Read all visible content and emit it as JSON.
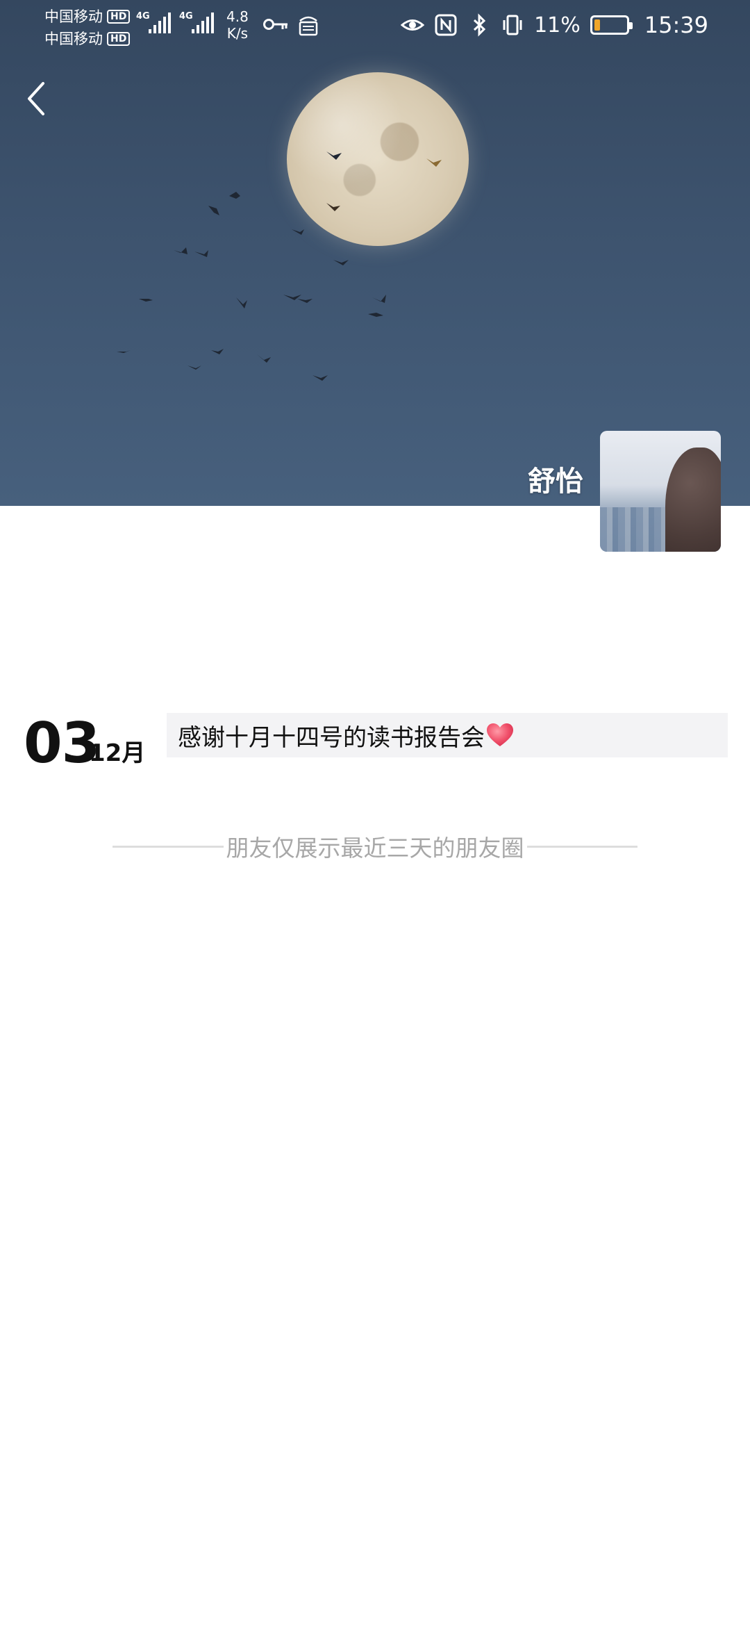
{
  "status_bar": {
    "carriers": [
      "中国移动",
      "中国移动"
    ],
    "hd_badge": "HD",
    "network_type": "4G",
    "net_speed_value": "4.8",
    "net_speed_unit": "K/s",
    "battery_percent": "11%",
    "battery_level": 0.11,
    "time": "15:39",
    "icons": [
      "key-icon",
      "vpn-icon",
      "eye-icon",
      "nfc-icon",
      "bluetooth-icon",
      "vibrate-icon",
      "battery-icon"
    ]
  },
  "header": {
    "back_icon": "chevron-left-icon",
    "user_name": "舒怡"
  },
  "posts": [
    {
      "day": "03",
      "month": "12月",
      "text": "感谢十月十四号的读书报告会",
      "emoji": "heart-icon"
    }
  ],
  "footer_notice": "朋友仅展示最近三天的朋友圈",
  "colors": {
    "cover_sky": "#3d536e",
    "post_bg": "#f3f3f5",
    "divider_text": "#a7a7a7",
    "battery_fill": "#f0a62a"
  }
}
